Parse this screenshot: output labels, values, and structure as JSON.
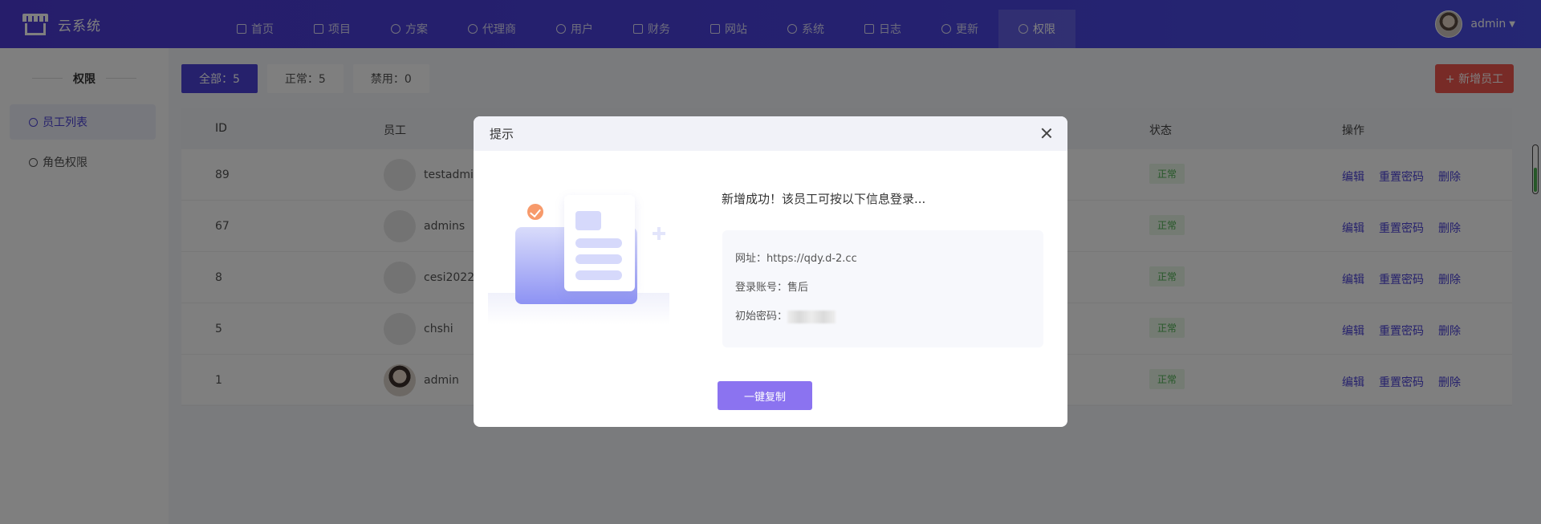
{
  "app": {
    "name": "云系统"
  },
  "nav": [
    {
      "label": "首页",
      "icon": "home-icon"
    },
    {
      "label": "项目",
      "icon": "briefcase-icon"
    },
    {
      "label": "方案",
      "icon": "heart-icon"
    },
    {
      "label": "代理商",
      "icon": "users-icon"
    },
    {
      "label": "用户",
      "icon": "user-icon"
    },
    {
      "label": "财务",
      "icon": "finance-icon"
    },
    {
      "label": "网站",
      "icon": "website-icon"
    },
    {
      "label": "系统",
      "icon": "settings-icon"
    },
    {
      "label": "日志",
      "icon": "log-icon"
    },
    {
      "label": "更新",
      "icon": "refresh-icon"
    },
    {
      "label": "权限",
      "icon": "shield-icon"
    }
  ],
  "user": {
    "name": "admin"
  },
  "sidebar": {
    "title": "权限",
    "items": [
      {
        "label": "员工列表"
      },
      {
        "label": "角色权限"
      }
    ]
  },
  "filters": [
    {
      "label": "全部：5"
    },
    {
      "label": "正常：5"
    },
    {
      "label": "禁用：0"
    }
  ],
  "add_button": "+ 新增员工",
  "table": {
    "headers": {
      "id": "ID",
      "employee": "员工",
      "status": "状态",
      "actions": "操作"
    },
    "rows": [
      {
        "id": "89",
        "name": "testadmin",
        "status": "正常"
      },
      {
        "id": "67",
        "name": "admins",
        "status": "正常"
      },
      {
        "id": "8",
        "name": "cesi2022",
        "status": "正常"
      },
      {
        "id": "5",
        "name": "chshi",
        "status": "正常"
      },
      {
        "id": "1",
        "name": "admin",
        "status": "正常"
      }
    ],
    "action_labels": {
      "edit": "编辑",
      "reset": "重置密码",
      "delete": "删除"
    }
  },
  "modal": {
    "title": "提示",
    "message": "新增成功！该员工可按以下信息登录...",
    "url": "网址：https://qdy.d-2.cc",
    "account": "登录账号：售后",
    "password_label": "初始密码：",
    "copy_button": "一键复制"
  }
}
